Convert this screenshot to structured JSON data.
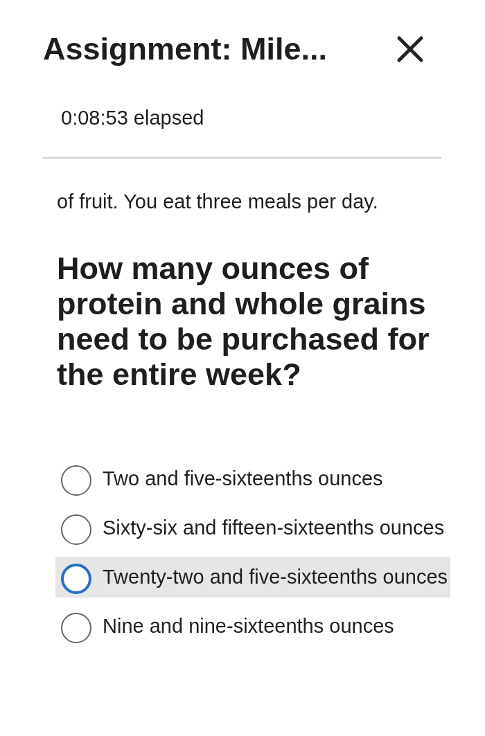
{
  "header": {
    "title": "Assignment: Mile...",
    "timer": "0:08:53 elapsed"
  },
  "passage": "of fruit. You eat three meals per day.",
  "question": "How many ounces of protein and whole grains need to be purchased for the entire week?",
  "options": [
    {
      "label": "Two and five-sixteenths ounces",
      "highlighted": false
    },
    {
      "label": "Sixty-six and fifteen-sixteenths ounces",
      "highlighted": false
    },
    {
      "label": "Twenty-two and five-sixteenths ounces",
      "highlighted": true
    },
    {
      "label": "Nine and nine-sixteenths ounces",
      "highlighted": false
    }
  ]
}
